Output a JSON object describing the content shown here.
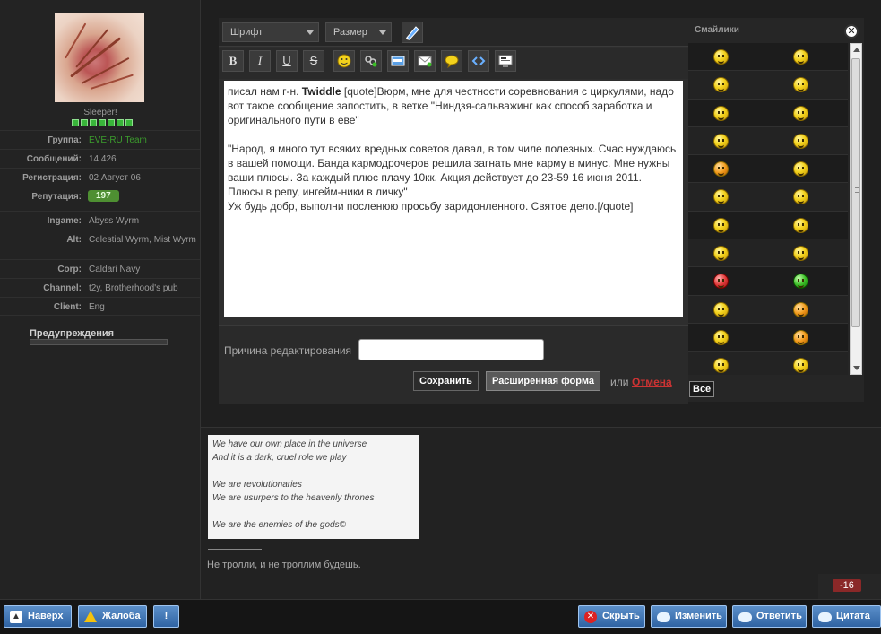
{
  "profile": {
    "username": "Sleeper!",
    "rows": [
      {
        "label": "Группа:",
        "value": "EVE-RU Team",
        "green": true
      },
      {
        "label": "Сообщений:",
        "value": "14 426"
      },
      {
        "label": "Регистрация:",
        "value": "02 Август 06"
      },
      {
        "label": "Репутация:",
        "value": "197",
        "badge": true
      },
      {
        "label": "Ingame:",
        "value": "Abyss Wyrm"
      },
      {
        "label": "Alt:",
        "value": "Celestial Wyrm, Mist Wyrm"
      },
      {
        "label": "Corp:",
        "value": "Caldari Navy"
      },
      {
        "label": "Channel:",
        "value": "t2y, Brotherhood's pub"
      },
      {
        "label": "Client:",
        "value": "Eng"
      }
    ],
    "warnings_title": "Предупреждения"
  },
  "editor": {
    "font_select": "Шрифт",
    "size_select": "Размер",
    "toolbar": {
      "bold": "B",
      "italic": "I",
      "underline": "U",
      "strike": "S"
    },
    "text_pre": "писал нам г-н. ",
    "text_bold": "Twiddle",
    "text_post": " [quote]Вюрм, мне для честности соревнования с циркулями, надо вот такое сообщение запостить, в ветке \"Ниндзя-сальважинг как способ заработка и оригинального пути в еве\"\n\n\"Народ, я много тут всяких вредных советов давал, в том чиле полезных. Счас нуждаюсь в вашей помощи. Банда кармодрочеров решила загнать мне карму в минус. Мне нужны ваши плюсы. За каждый плюс плачу 10кк. Акция действует до 23-59 16 июня 2011. Плюсы в репу, ингейм-ники в личку\"\nУж будь добр, выполни посленюю просьбу заридонленного. Святое дело.[/quote]",
    "reason_label": "Причина редактирования",
    "save_label": "Сохранить",
    "advanced_label": "Расширенная форма",
    "or_label": "или",
    "cancel_label": "Отмена"
  },
  "smiles": {
    "title": "Смайлики",
    "close": "✕",
    "all_label": "Все"
  },
  "signature": {
    "lines": "We have our own place in the universe\nAnd it is a dark, cruel role we play\n\nWe are revolutionaries\nWe are usurpers to the heavenly thrones\n\nWe are the enemies of the gods©",
    "text": "Не тролли, и не троллим будешь."
  },
  "score": "-16",
  "bottombar": {
    "top_label": "Наверх",
    "complaint_label": "Жалоба",
    "warn_label": "!",
    "hide_label": "Скрыть",
    "edit_label": "Изменить",
    "reply_label": "Ответить",
    "quote_label": "Цитата"
  },
  "colors": {
    "accent": "#3c9d2d",
    "cancel": "#cc3333",
    "button_blue": "#2f63a3"
  }
}
